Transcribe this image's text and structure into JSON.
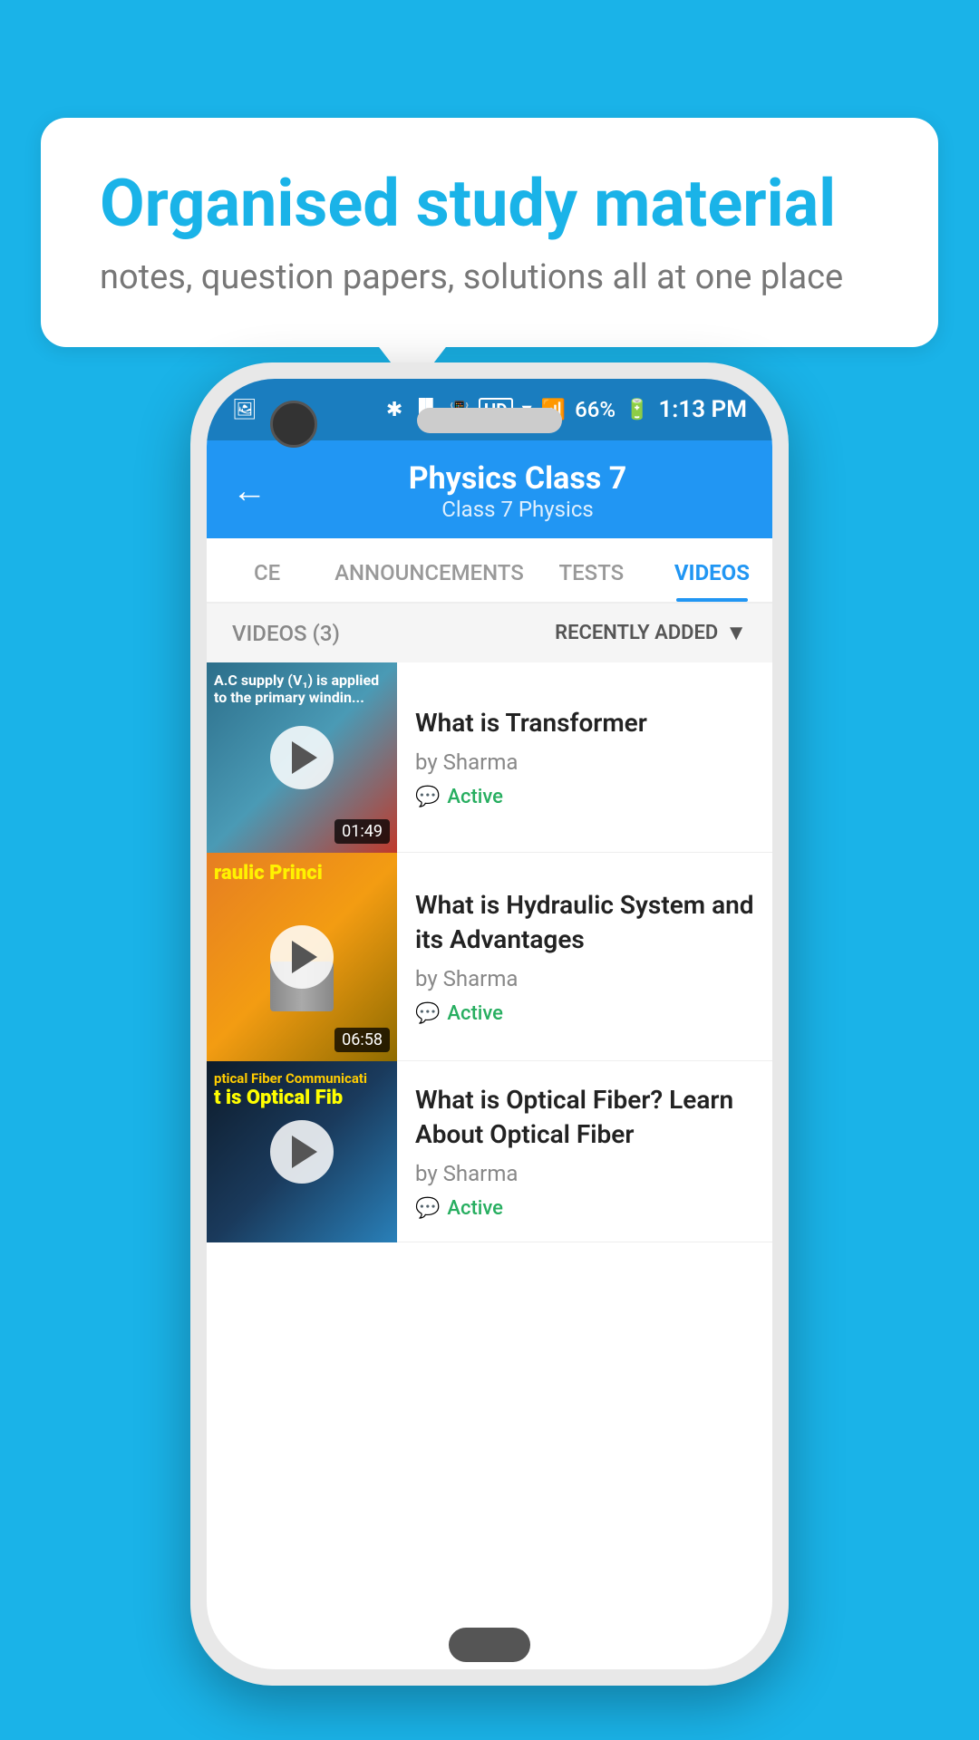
{
  "background_color": "#1ab3e8",
  "speech_bubble": {
    "title": "Organised study material",
    "subtitle": "notes, question papers, solutions all at one place"
  },
  "phone": {
    "status_bar": {
      "time": "1:13 PM",
      "battery": "66%",
      "signal_icons": [
        "bluetooth",
        "vibrate",
        "hd",
        "wifi",
        "signal",
        "x"
      ]
    },
    "header": {
      "back_label": "←",
      "title": "Physics Class 7",
      "breadcrumb": "Class 7    Physics"
    },
    "tabs": [
      {
        "id": "ce",
        "label": "CE",
        "active": false
      },
      {
        "id": "announcements",
        "label": "ANNOUNCEMENTS",
        "active": false
      },
      {
        "id": "tests",
        "label": "TESTS",
        "active": false
      },
      {
        "id": "videos",
        "label": "VIDEOS",
        "active": true
      }
    ],
    "filter_bar": {
      "count_label": "VIDEOS (3)",
      "sort_label": "RECENTLY ADDED"
    },
    "videos": [
      {
        "id": 1,
        "title": "What is  Transformer",
        "author": "by Sharma",
        "status": "Active",
        "duration": "01:49",
        "thumb_text": ""
      },
      {
        "id": 2,
        "title": "What is Hydraulic System and its Advantages",
        "author": "by Sharma",
        "status": "Active",
        "duration": "06:58",
        "thumb_text": "raulic Princi"
      },
      {
        "id": 3,
        "title": "What is Optical Fiber? Learn About Optical Fiber",
        "author": "by Sharma",
        "status": "Active",
        "duration": "",
        "thumb_text": "ptical Fiber Communicati"
      }
    ]
  }
}
